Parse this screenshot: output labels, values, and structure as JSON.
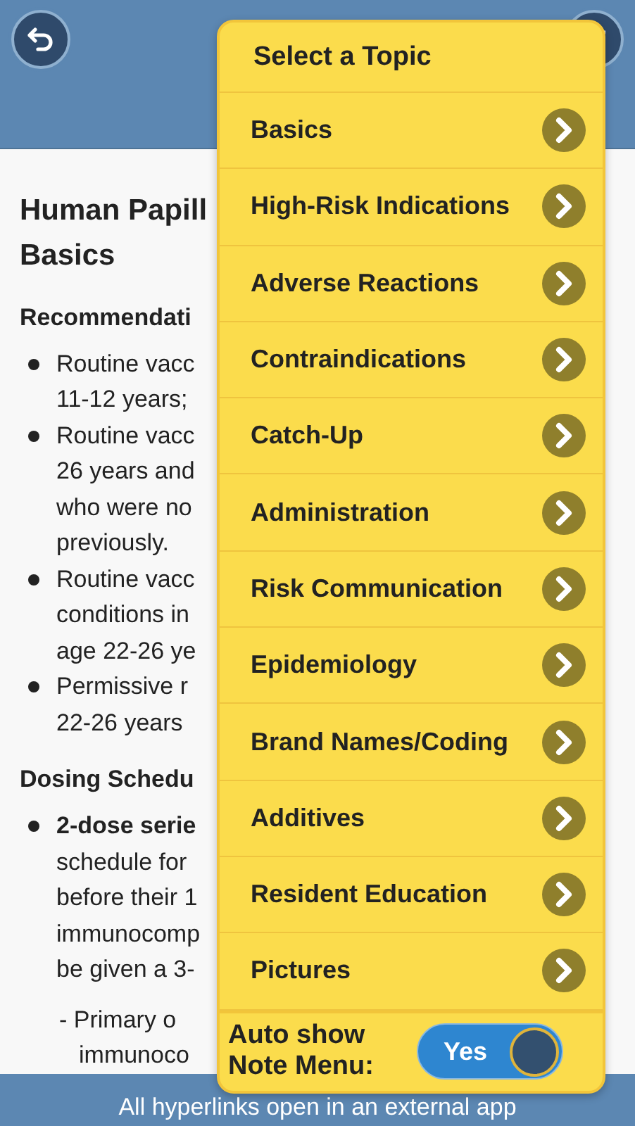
{
  "article": {
    "title_lines": [
      "Human Papill",
      "Basics"
    ],
    "sections": [
      {
        "heading": "Recommendati",
        "bullets": [
          {
            "lines": [
              "Routine vacc",
              "11-12 years;"
            ]
          },
          {
            "lines": [
              "Routine vacc",
              "26 years and",
              "who were no",
              "previously."
            ]
          },
          {
            "lines": [
              "Routine vacc",
              "conditions in",
              "age 22-26 ye"
            ]
          },
          {
            "lines": [
              "Permissive r",
              "22-26 years"
            ]
          }
        ]
      },
      {
        "heading": "Dosing Schedu",
        "bullets": [
          {
            "lines": [
              "2-dose serie",
              "schedule for",
              "before their 1",
              "immunocomp",
              "be given a 3-"
            ],
            "bold_first": true
          },
          {
            "lines": [
              "- Primary o",
              "immunoco"
            ],
            "kind": "sub"
          }
        ]
      }
    ]
  },
  "topic_menu": {
    "title": "Select a Topic",
    "items": [
      {
        "label": "Basics"
      },
      {
        "label": "High-Risk Indications"
      },
      {
        "label": "Adverse Reactions"
      },
      {
        "label": "Contraindications"
      },
      {
        "label": "Catch-Up"
      },
      {
        "label": "Administration"
      },
      {
        "label": "Risk Communication"
      },
      {
        "label": "Epidemiology"
      },
      {
        "label": "Brand Names/Coding"
      },
      {
        "label": "Additives"
      },
      {
        "label": "Resident Education"
      },
      {
        "label": "Pictures"
      }
    ],
    "auto_show": {
      "label": "Auto show Note Menu:",
      "value": "Yes",
      "on": true
    }
  },
  "footer": {
    "text": "All hyperlinks open in an external app"
  }
}
